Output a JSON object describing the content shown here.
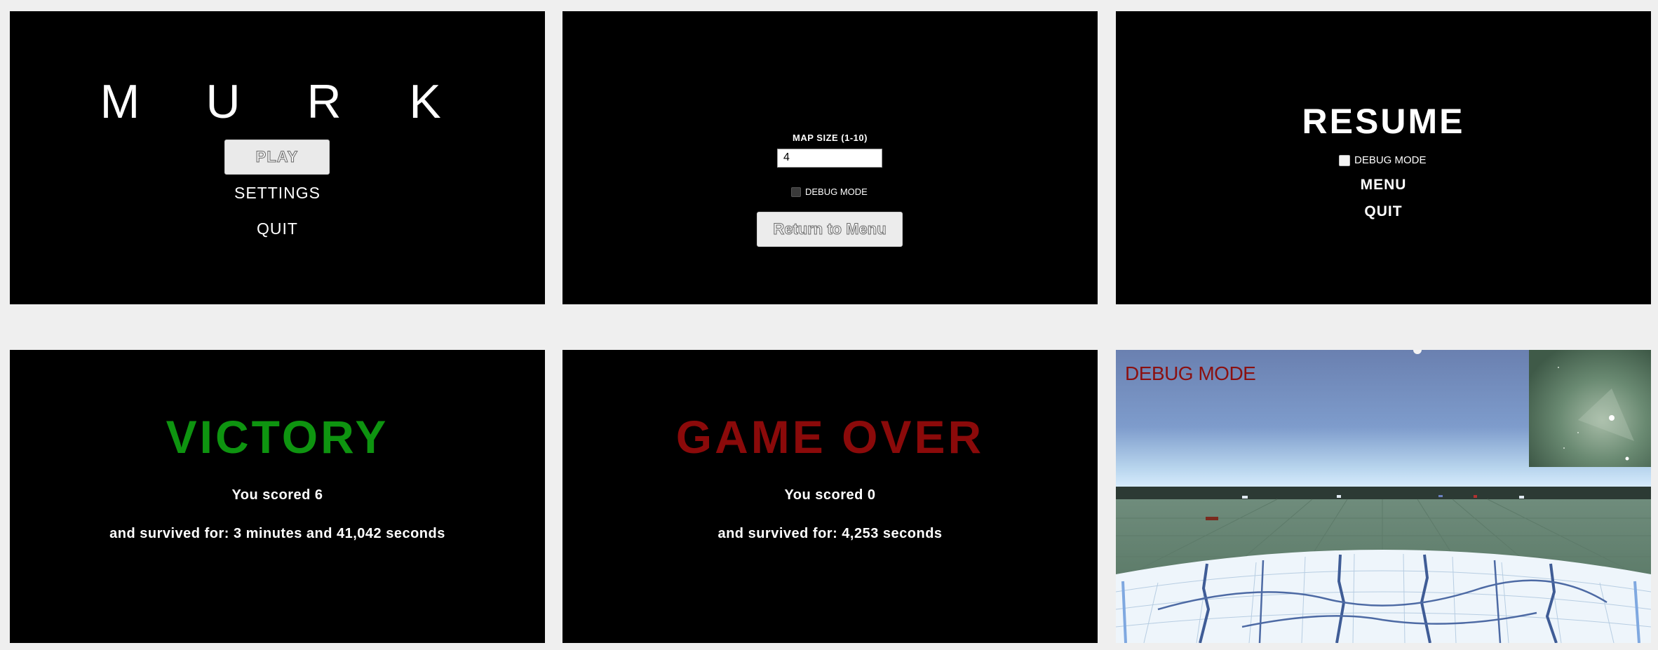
{
  "main_menu": {
    "title_letters": [
      "M",
      "U",
      "R",
      "K"
    ],
    "play_label": "PLAY",
    "settings_label": "SETTINGS",
    "quit_label": "QUIT"
  },
  "settings": {
    "map_size_label": "MAP SIZE (1-10)",
    "map_size_value": "4",
    "debug_mode_label": "DEBUG MODE",
    "return_label": "Return to Menu"
  },
  "pause": {
    "resume_label": "RESUME",
    "debug_mode_label": "DEBUG MODE",
    "menu_label": "MENU",
    "quit_label": "QUIT"
  },
  "victory": {
    "title": "VICTORY",
    "score_text": "You scored 6",
    "survived_text": "and survived for: 3 minutes and 41,042 seconds",
    "color": "#0e9410"
  },
  "game_over": {
    "title": "GAME OVER",
    "score_text": "You scored 0",
    "survived_text": "and survived for: 4,253 seconds",
    "color": "#8b0a0a"
  },
  "debug_view": {
    "label": "DEBUG MODE",
    "label_color": "#8b1010"
  }
}
